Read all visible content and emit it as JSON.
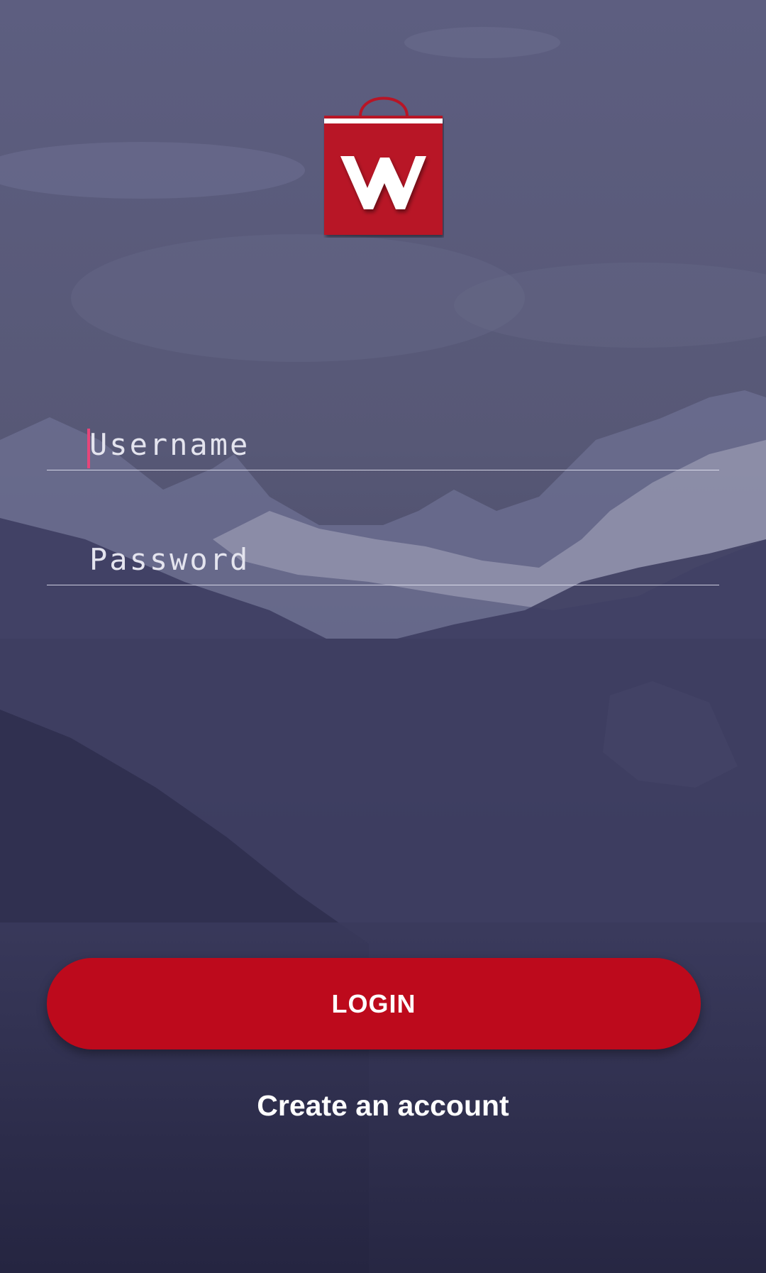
{
  "logo": {
    "name": "shopping-bag-w-logo",
    "bag_color": "#b81526",
    "letter": "W"
  },
  "form": {
    "username_placeholder": "Username",
    "password_placeholder": "Password"
  },
  "actions": {
    "login_label": "LOGIN",
    "create_account_label": "Create an account"
  },
  "colors": {
    "overlay": "#2e2e52",
    "accent": "#bd0a1c",
    "cursor": "#e6457a"
  }
}
